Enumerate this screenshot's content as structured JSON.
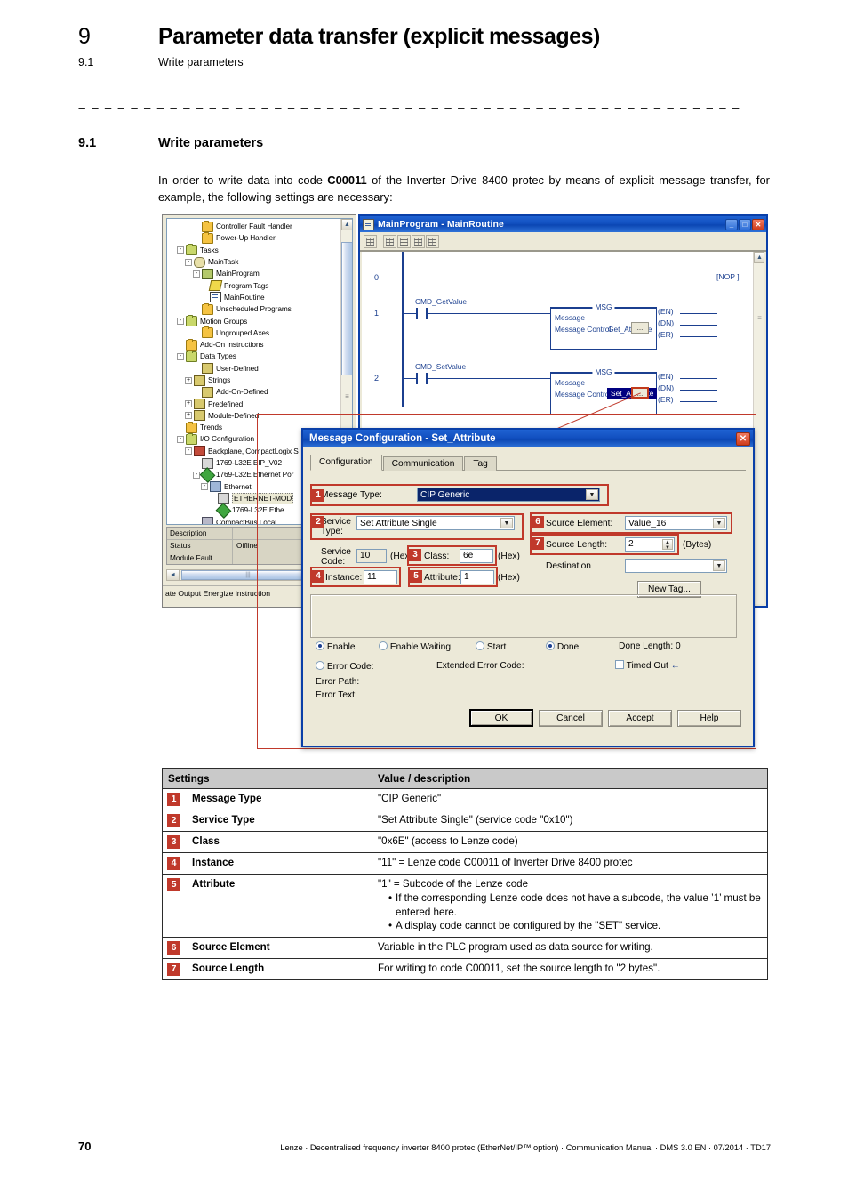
{
  "page": {
    "chapter_number": "9",
    "chapter_title": "Parameter data transfer (explicit messages)",
    "sub_number": "9.1",
    "sub_title": "Write parameters",
    "dash_rule": "– – – – – – – – – – – – – – – – – – – – – – – – – – – – – – – – – – – – – – – – – – – – – – – – – – –",
    "section_number": "9.1",
    "section_title": "Write parameters",
    "intro_part1": "In order to write data into code ",
    "intro_bold": "C00011",
    "intro_part2": " of the Inverter Drive 8400 protec by means of explicit message transfer, for example, the following settings are necessary:",
    "page_number": "70",
    "footer": "Lenze · Decentralised frequency inverter 8400 protec (EtherNet/IP™ option) · Communication Manual · DMS 3.0 EN · 07/2014 · TD17"
  },
  "colors": {
    "accent_red": "#c0392b",
    "title_blue": "#0b46b3",
    "ladder_blue": "#1b3f8f",
    "table_header_gray": "#c9c9c9",
    "dialog_face": "#ece9d8",
    "selection_navy": "#000080"
  },
  "tree": {
    "nodes": [
      {
        "label": "Controller Fault Handler",
        "indent": 3,
        "expander": "",
        "icon": "folder-icon"
      },
      {
        "label": "Power-Up Handler",
        "indent": 3,
        "expander": "",
        "icon": "folder-icon"
      },
      {
        "label": "Tasks",
        "indent": 1,
        "expander": "-",
        "icon": "folder-green-icon"
      },
      {
        "label": "MainTask",
        "indent": 2,
        "expander": "-",
        "icon": "task-icon"
      },
      {
        "label": "MainProgram",
        "indent": 3,
        "expander": "-",
        "icon": "program-icon"
      },
      {
        "label": "Program Tags",
        "indent": 4,
        "expander": "",
        "icon": "tags-icon"
      },
      {
        "label": "MainRoutine",
        "indent": 4,
        "expander": "",
        "icon": "routine-icon"
      },
      {
        "label": "Unscheduled Programs",
        "indent": 3,
        "expander": "",
        "icon": "folder-icon"
      },
      {
        "label": "Motion Groups",
        "indent": 1,
        "expander": "-",
        "icon": "folder-green-icon"
      },
      {
        "label": "Ungrouped Axes",
        "indent": 3,
        "expander": "",
        "icon": "folder-icon"
      },
      {
        "label": "Add-On Instructions",
        "indent": 1,
        "expander": "",
        "icon": "folder-icon"
      },
      {
        "label": "Data Types",
        "indent": 1,
        "expander": "-",
        "icon": "folder-green-icon"
      },
      {
        "label": "User-Defined",
        "indent": 3,
        "expander": "",
        "icon": "datatype-icon"
      },
      {
        "label": "Strings",
        "indent": 2,
        "expander": "+",
        "icon": "datatype-icon"
      },
      {
        "label": "Add-On-Defined",
        "indent": 3,
        "expander": "",
        "icon": "datatype-icon"
      },
      {
        "label": "Predefined",
        "indent": 2,
        "expander": "+",
        "icon": "datatype-icon"
      },
      {
        "label": "Module-Defined",
        "indent": 2,
        "expander": "+",
        "icon": "datatype-icon"
      },
      {
        "label": "Trends",
        "indent": 1,
        "expander": "",
        "icon": "folder-icon"
      },
      {
        "label": "I/O Configuration",
        "indent": 1,
        "expander": "-",
        "icon": "folder-green-icon"
      },
      {
        "label": "Backplane, CompactLogix S",
        "indent": 2,
        "expander": "-",
        "icon": "rack-icon"
      },
      {
        "label": "1769-L32E EIP_V02",
        "indent": 3,
        "expander": "",
        "icon": "module-icon"
      },
      {
        "label": "1769-L32E Ethernet Por",
        "indent": 3,
        "expander": "-",
        "icon": "ethernet-icon"
      },
      {
        "label": "Ethernet",
        "indent": 4,
        "expander": "-",
        "icon": "hub-icon"
      },
      {
        "label": "ETHERNET-MOD",
        "indent": 5,
        "expander": "",
        "icon": "module-icon",
        "selected": true
      },
      {
        "label": "1769-L32E Ethe",
        "indent": 5,
        "expander": "",
        "icon": "ethernet-icon"
      },
      {
        "label": "CompactBus Local",
        "indent": 3,
        "expander": "",
        "icon": "bus-icon"
      }
    ],
    "properties": [
      {
        "key": "Description",
        "value": ""
      },
      {
        "key": "Status",
        "value": "Offline"
      },
      {
        "key": "Module Fault",
        "value": ""
      }
    ],
    "statusbar": "ate Output Energize instruction"
  },
  "main_program": {
    "title": "MainProgram - MainRoutine",
    "minimize_label": "_",
    "maximize_label": "□",
    "close_label": "✕",
    "rungs": [
      {
        "number": "0",
        "coil": "[NOP ]",
        "input": "",
        "box": null
      },
      {
        "number": "1",
        "input": "CMD_GetValue",
        "box": {
          "tag": "MSG",
          "line1": "Message",
          "line2": "Message Control",
          "value": "Get_Attribute",
          "ellipsis": "...",
          "selected": false
        },
        "coils": [
          "(EN)",
          "(DN)",
          "(ER)"
        ]
      },
      {
        "number": "2",
        "input": "CMD_SetValue",
        "box": {
          "tag": "MSG",
          "line1": "Message",
          "line2": "Message Control",
          "value": "Set_Attribute",
          "ellipsis": "...",
          "selected": true
        },
        "coils": [
          "(EN)",
          "(DN)",
          "(ER)"
        ]
      }
    ]
  },
  "dialog": {
    "title": "Message Configuration - Set_Attribute",
    "close_label": "✕",
    "tabs": [
      {
        "label": "Configuration",
        "active": true
      },
      {
        "label": "Communication",
        "active": false
      },
      {
        "label": "Tag",
        "active": false
      }
    ],
    "fields": {
      "message_type_label": "Message Type:",
      "message_type_value": "CIP Generic",
      "service_type_label_l1": "Service",
      "service_type_label_l2": "Type:",
      "service_type_value": "Set Attribute Single",
      "service_code_label_l1": "Service",
      "service_code_label_l2": "Code:",
      "service_code_value": "10",
      "service_code_hex": "(Hex)",
      "class_label": "Class:",
      "class_value": "6e",
      "class_hex": "(Hex)",
      "instance_label": "Instance:",
      "instance_value": "11",
      "attribute_label": "Attribute:",
      "attribute_value": "1",
      "attribute_hex": "(Hex)",
      "source_element_label": "Source Element:",
      "source_element_value": "Value_16",
      "source_length_label": "Source Length:",
      "source_length_value": "2",
      "source_length_unit": "(Bytes)",
      "destination_label": "Destination",
      "destination_value": "",
      "new_tag_label": "New Tag..."
    },
    "status": {
      "enable_label": "Enable",
      "enable_waiting_label": "Enable Waiting",
      "start_label": "Start",
      "done_label": "Done",
      "done_length_label": "Done Length:  0",
      "error_code_label": "Error Code:",
      "extended_error_code_label": "Extended Error Code:",
      "timed_out_label": "Timed Out",
      "timed_out_arrow": "←",
      "error_path_label": "Error Path:",
      "error_text_label": "Error Text:"
    },
    "buttons": {
      "ok": "OK",
      "cancel": "Cancel",
      "accept": "Accept",
      "help": "Help"
    },
    "badges": [
      "1",
      "2",
      "3",
      "4",
      "5",
      "6",
      "7"
    ]
  },
  "table": {
    "headers": [
      "Settings",
      "Value / description"
    ],
    "rows": [
      {
        "badge": "1",
        "name": "Message Type",
        "value": "\"CIP Generic\"",
        "bullets": []
      },
      {
        "badge": "2",
        "name": "Service Type",
        "value": "\"Set Attribute Single\" (service code \"0x10\")",
        "bullets": []
      },
      {
        "badge": "3",
        "name": "Class",
        "value": "\"0x6E\" (access to Lenze code)",
        "bullets": []
      },
      {
        "badge": "4",
        "name": "Instance",
        "value": "\"11\" = Lenze code C00011 of Inverter Drive 8400 protec",
        "bullets": []
      },
      {
        "badge": "5",
        "name": "Attribute",
        "value": "\"1\" = Subcode of the Lenze code",
        "bullets": [
          "If the corresponding Lenze code does not have a subcode, the value ’1’ must be entered here.",
          "A display code cannot be configured by the \"SET\" service."
        ]
      },
      {
        "badge": "6",
        "name": "Source Element",
        "value": "Variable in the PLC program used as data source for writing.",
        "bullets": []
      },
      {
        "badge": "7",
        "name": "Source Length",
        "value": "For writing to code C00011, set the source length to \"2 bytes\".",
        "bullets": []
      }
    ]
  }
}
